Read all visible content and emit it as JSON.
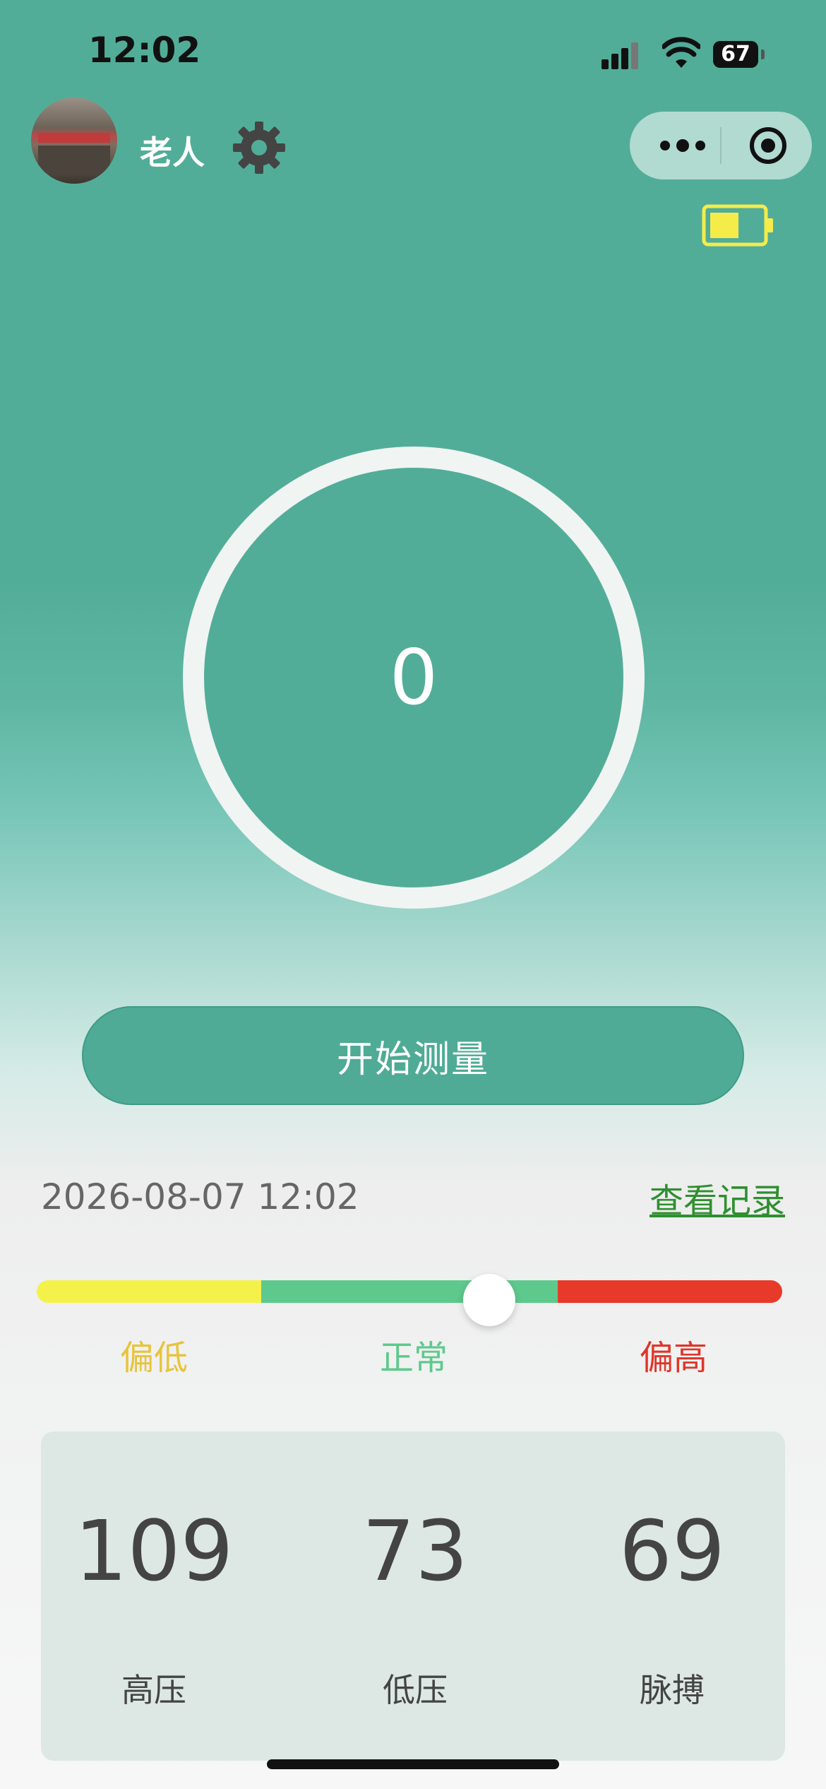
{
  "status_bar": {
    "time": "12:02",
    "battery_level": "67"
  },
  "header": {
    "user_name": "老人",
    "avatar_label": "avatar",
    "settings_icon": "gear-icon"
  },
  "capsule": {
    "more_icon": "more-dots-icon",
    "close_icon": "target-icon"
  },
  "device": {
    "battery_icon": "battery-icon",
    "battery_color": "#f5ec4a"
  },
  "dial": {
    "value": "0"
  },
  "actions": {
    "start_label": "开始测量"
  },
  "summary": {
    "datetime": "2026-08-07 12:02",
    "records_link": "查看记录"
  },
  "scale": {
    "labels": [
      "偏低",
      "正常",
      "偏高"
    ],
    "colors": {
      "low": "#f4f24a",
      "normal": "#5ec98c",
      "high": "#e83a2a"
    }
  },
  "readings": [
    {
      "value": "109",
      "label": "高压"
    },
    {
      "value": "73",
      "label": "低压"
    },
    {
      "value": "69",
      "label": "脉搏"
    }
  ]
}
